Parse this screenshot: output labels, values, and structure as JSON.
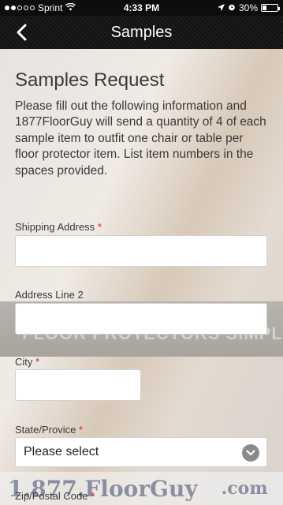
{
  "status": {
    "carrier": "Sprint",
    "time": "4:33 PM",
    "battery": "30%",
    "battery_level": 0.3
  },
  "nav": {
    "title": "Samples"
  },
  "form": {
    "heading": "Samples Request",
    "intro": "Please fill out the following information and 1877FloorGuy will send a quantity of 4 of each sample item to outfit one chair or table per floor protector item. List item numbers in the spaces provided.",
    "shipping_label": "Shipping Address",
    "address2_label": "Address Line 2",
    "city_label": "City",
    "state_label": "State/Provice",
    "state_value": "Please select",
    "zip_label": "Zip/Postal Code",
    "required_mark": "*"
  },
  "background": {
    "banner": "FLOOR PROTECTORS SIMPLIFIED",
    "logo": "1.877.FloorGuy",
    "logo_suffix": ".com"
  },
  "icons": [
    "back-chevron-icon",
    "wifi-icon",
    "location-arrow-icon",
    "alarm-icon",
    "battery-icon",
    "chevron-down-icon"
  ],
  "colors": {
    "required": "#d0232c",
    "navbar": "#151515"
  }
}
